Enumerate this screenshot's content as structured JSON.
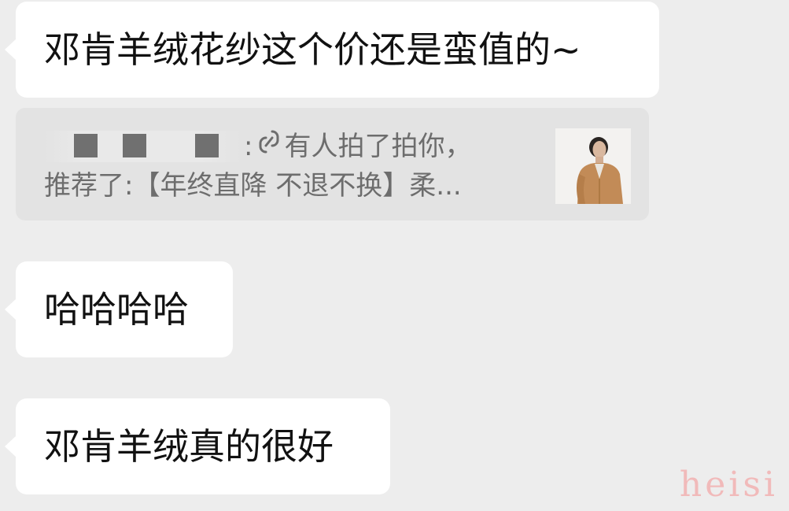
{
  "messages": [
    {
      "text": "邓肯羊绒花纱这个价还是蛮值的~"
    },
    {
      "text": "哈哈哈哈"
    },
    {
      "text": "邓肯羊绒真的很好"
    }
  ],
  "pat_card": {
    "name_redacted": true,
    "colon": ":",
    "link_icon": "link-icon",
    "pat_text": "有人拍了拍你，",
    "recommend_text": "推荐了:【年终直降 不退不换】柔...",
    "thumbnail": "product-photo-woman-cardigan"
  },
  "watermark": "heisi",
  "colors": {
    "background": "#ededed",
    "bubble": "#ffffff",
    "system_card": "#e3e3e3",
    "system_text": "#6d6d6d",
    "watermark": "#f2b5b5"
  }
}
